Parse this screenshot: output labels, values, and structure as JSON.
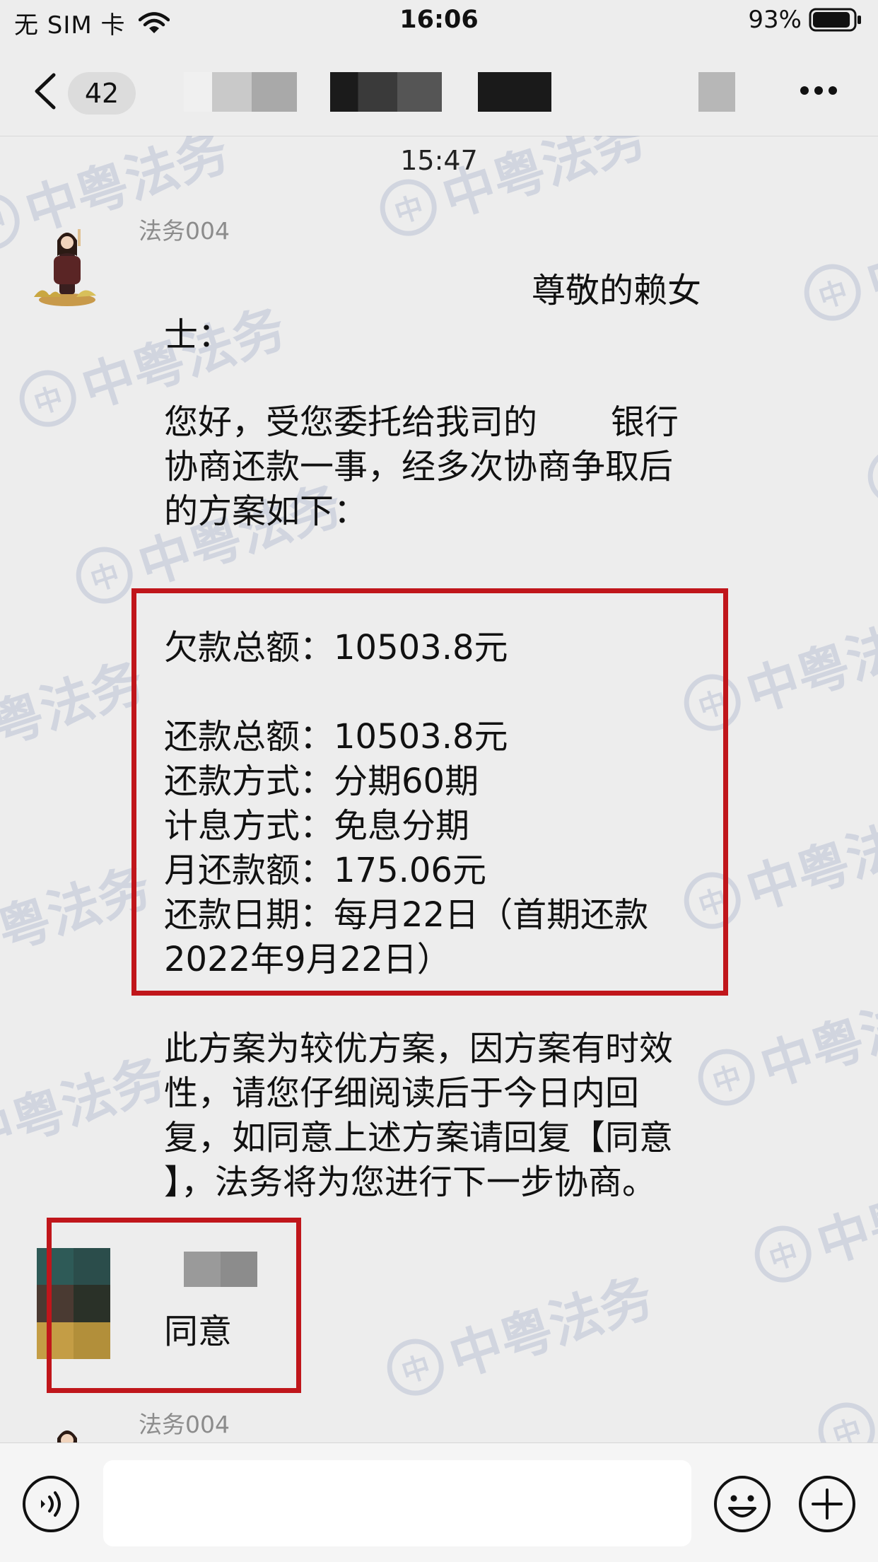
{
  "status_bar": {
    "carrier": "无 SIM 卡",
    "time": "16:06",
    "battery_percent": "93%",
    "battery_level": 0.93
  },
  "nav": {
    "unread_count": "42"
  },
  "watermark": "中粤法务",
  "chat": {
    "timestamp": "15:47",
    "messages": [
      {
        "sender": "法务004",
        "greeting": "尊敬的赖女",
        "greeting_cont": "士：",
        "intro": [
          "您好，受您委托给我司的",
          "银行",
          "协商还款一事，经多次协商争取后",
          "的方案如下："
        ],
        "plan": [
          "欠款总额：10503.8元",
          "还款总额：10503.8元",
          "还款方式：分期60期",
          "计息方式：免息分期",
          "月还款额：175.06元",
          "还款日期：每月22日（首期还款",
          "2022年9月22日）"
        ],
        "closing": [
          "此方案为较优方案，因方案有时效",
          "性，请您仔细阅读后于今日内回",
          "复，如同意上述方案请回复【同意",
          "】，法务将为您进行下一步协商。"
        ]
      },
      {
        "sender": "",
        "text": "同意"
      },
      {
        "sender": "法务004"
      }
    ]
  },
  "input_bar": {
    "placeholder": ""
  },
  "colors": {
    "highlight_border": "#c0161b",
    "background": "#ededed",
    "watermark": "#1d3b8b"
  },
  "icons": [
    "wifi-icon",
    "battery-icon",
    "back-icon",
    "more-icon",
    "voice-icon",
    "emoji-icon",
    "plus-icon"
  ]
}
